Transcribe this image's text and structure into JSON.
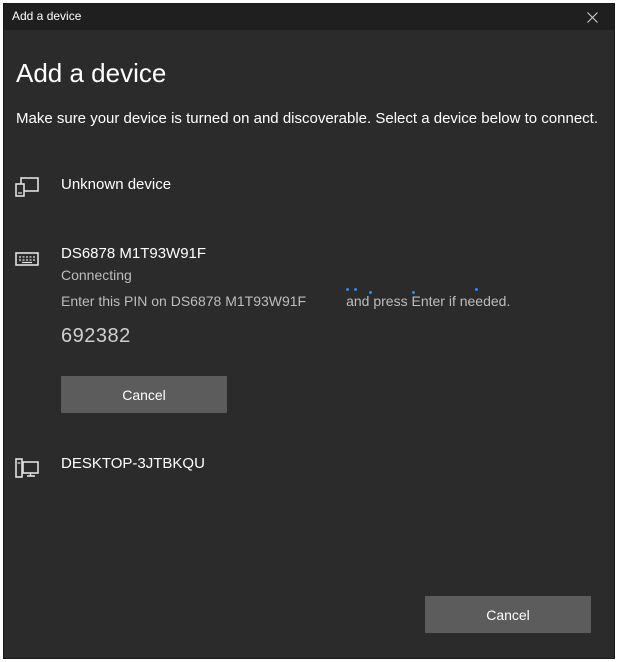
{
  "window": {
    "title": "Add a device"
  },
  "heading": "Add a device",
  "instructions": "Make sure your device is turned on and discoverable. Select a device below to connect.",
  "devices": [
    {
      "name": "Unknown device",
      "icon": "display-device-icon"
    },
    {
      "name": "DS6878 M1T93W91F",
      "icon": "keyboard-icon",
      "status": "Connecting",
      "pin_prompt_before": "Enter this PIN on DS6878 M1T93W91F",
      "pin_prompt_after": "and press Enter if needed.",
      "pin": "692382",
      "cancel_label": "Cancel"
    },
    {
      "name": "DESKTOP-3JTBKQU",
      "icon": "computer-icon"
    }
  ],
  "footer": {
    "cancel_label": "Cancel"
  },
  "colors": {
    "background": "#2b2b2b",
    "titlebar": "#1f1f1f",
    "button": "#5c5c5c",
    "progress_dots": "#2f8ae6"
  }
}
